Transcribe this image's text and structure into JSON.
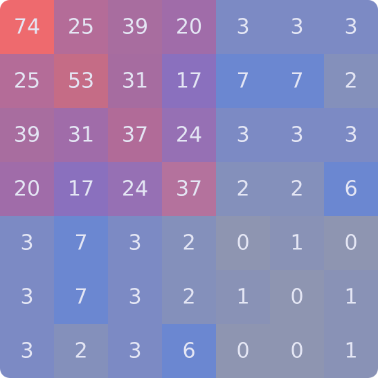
{
  "chart_data": {
    "type": "heatmap",
    "title": "",
    "xlabel": "",
    "ylabel": "",
    "rows": 7,
    "cols": 7,
    "values": [
      [
        74,
        25,
        39,
        20,
        3,
        3,
        3
      ],
      [
        25,
        53,
        31,
        17,
        7,
        7,
        2
      ],
      [
        39,
        31,
        37,
        24,
        3,
        3,
        3
      ],
      [
        20,
        17,
        24,
        37,
        2,
        2,
        6
      ],
      [
        3,
        7,
        3,
        2,
        0,
        1,
        0
      ],
      [
        3,
        7,
        3,
        2,
        1,
        0,
        1
      ],
      [
        3,
        2,
        3,
        6,
        0,
        0,
        1
      ]
    ],
    "cell_colors": [
      [
        "#ee6a6e",
        "#b46c98",
        "#a86d9f",
        "#a06ca9",
        "#7c8ac4",
        "#7c8ac4",
        "#7c8ac4"
      ],
      [
        "#b46c98",
        "#c56c86",
        "#a66ca0",
        "#8a70be",
        "#6b87d1",
        "#6b87d1",
        "#8490bb"
      ],
      [
        "#a86d9f",
        "#a06ca9",
        "#b16b98",
        "#9670b4",
        "#7c8ac4",
        "#7c8ac4",
        "#7c8ac4"
      ],
      [
        "#a06ca9",
        "#8a70be",
        "#9670b4",
        "#b4729d",
        "#8490bb",
        "#8490bb",
        "#6b87d1"
      ],
      [
        "#7c8ac4",
        "#6b87d1",
        "#7c8ac4",
        "#8490bb",
        "#8e95b1",
        "#8992b6",
        "#8e95b1"
      ],
      [
        "#7c8ac4",
        "#6b87d1",
        "#7c8ac4",
        "#8490bb",
        "#8992b6",
        "#8e95b1",
        "#8992b6"
      ],
      [
        "#7c8ac4",
        "#8490bb",
        "#7c8ac4",
        "#6b87d1",
        "#8e95b1",
        "#8e95b1",
        "#8992b6"
      ]
    ],
    "label_color": "#e4e6f4",
    "grid": false,
    "legend": "none"
  }
}
